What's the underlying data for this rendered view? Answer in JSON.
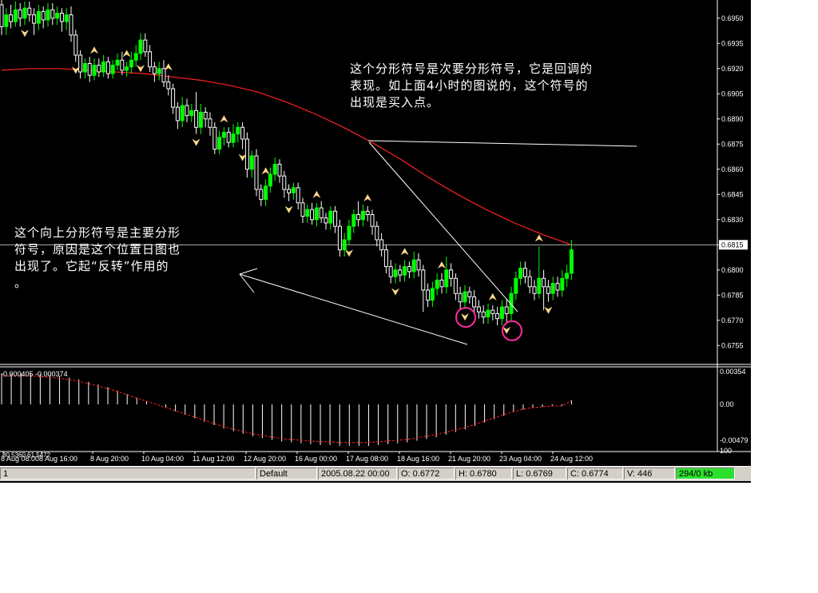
{
  "colors": {
    "background": "#000000",
    "grid_text": "#ffffff",
    "bull_candle": "#00ff00",
    "bear_candle": "#ffffff",
    "moving_average": "#ff2020",
    "fractal_arrow": "#ffd98a",
    "highlight_circle": "#ff2aa0",
    "indicator_bars": "#ffffff",
    "indicator_signal": "#ff2020",
    "traffic_indicator": "#2ee02e"
  },
  "price_axis": {
    "ticks": [
      "0.6950",
      "0.6935",
      "0.6920",
      "0.6905",
      "0.6890",
      "0.6875",
      "0.6860",
      "0.6845",
      "0.6830",
      "0.6815",
      "0.6800",
      "0.6785",
      "0.6770",
      "0.6755"
    ],
    "current_price": "0.6815"
  },
  "indicator": {
    "header": "-0.000405 -0.000374",
    "axis_ticks": [
      "0.00354",
      "0.00",
      "-0.00479",
      "100"
    ]
  },
  "time_axis": {
    "ticks": [
      "8 Aug 08:00",
      "8 Aug 16:00",
      "8 Aug 20:00",
      "10 Aug 04:00",
      "11 Aug 12:00",
      "12 Aug 20:00",
      "16 Aug 00:00",
      "17 Aug 08:00",
      "18 Aug 16:00",
      "21 Aug 20:00",
      "23 Aug 04:00",
      "24 Aug 12:00"
    ],
    "overlay_text": "80.5360  61.5472"
  },
  "annotations": {
    "note_right": "这个分形符号是次要分形符号，它是回调的\n表现。如上面4小时的图说的，这个符号的\n出现是买入点。",
    "note_left": "这个向上分形符号是主要分形\n符号，原因是这个位置日图也\n出现了。它起“反转”作用的\n。"
  },
  "status_bar": {
    "left": "1",
    "profile": "Default",
    "datetime": "2005.08.22 00:00",
    "open": "O: 0.6772",
    "high": "H: 0.6780",
    "low": "L: 0.6769",
    "close": "C: 0.6774",
    "volume": "V: 446",
    "traffic": "294/0 kb"
  },
  "chart_data": {
    "type": "candlestick",
    "price_range": [
      0.6748,
      0.6958
    ],
    "candles": [
      [
        0.6958,
        0.6945,
        0.6961,
        0.694
      ],
      [
        0.6945,
        0.6952,
        0.6956,
        0.694
      ],
      [
        0.6952,
        0.6948,
        0.6958,
        0.6944
      ],
      [
        0.6948,
        0.6955,
        0.696,
        0.6945
      ],
      [
        0.6955,
        0.695,
        0.6959,
        0.6945
      ],
      [
        0.695,
        0.6956,
        0.696,
        0.6946
      ],
      [
        0.6956,
        0.6952,
        0.696,
        0.6948
      ],
      [
        0.6952,
        0.6947,
        0.6956,
        0.694
      ],
      [
        0.6947,
        0.6954,
        0.6958,
        0.6943
      ],
      [
        0.6954,
        0.6949,
        0.6957,
        0.6944
      ],
      [
        0.6949,
        0.6955,
        0.6959,
        0.6945
      ],
      [
        0.6955,
        0.695,
        0.6959,
        0.6946
      ],
      [
        0.695,
        0.6953,
        0.6957,
        0.6946
      ],
      [
        0.6953,
        0.6948,
        0.6956,
        0.6942
      ],
      [
        0.6948,
        0.6952,
        0.6956,
        0.6943
      ],
      [
        0.6952,
        0.694,
        0.6957,
        0.6936
      ],
      [
        0.694,
        0.6928,
        0.6943,
        0.6924
      ],
      [
        0.6928,
        0.6918,
        0.6931,
        0.6914
      ],
      [
        0.6918,
        0.6923,
        0.6926,
        0.6914
      ],
      [
        0.6923,
        0.6916,
        0.6927,
        0.6912
      ],
      [
        0.6916,
        0.6922,
        0.6926,
        0.6913
      ],
      [
        0.6922,
        0.6918,
        0.6926,
        0.6915
      ],
      [
        0.6918,
        0.6924,
        0.6928,
        0.6915
      ],
      [
        0.6924,
        0.6917,
        0.6927,
        0.6914
      ],
      [
        0.6917,
        0.6922,
        0.6925,
        0.6914
      ],
      [
        0.6922,
        0.6925,
        0.6929,
        0.6919
      ],
      [
        0.6925,
        0.6919,
        0.693,
        0.6916
      ],
      [
        0.6919,
        0.6921,
        0.6924,
        0.6915
      ],
      [
        0.6921,
        0.6925,
        0.693,
        0.6917
      ],
      [
        0.6925,
        0.6929,
        0.6934,
        0.6921
      ],
      [
        0.6929,
        0.6937,
        0.6941,
        0.6925
      ],
      [
        0.6937,
        0.693,
        0.6941,
        0.6927
      ],
      [
        0.693,
        0.6921,
        0.6934,
        0.6918
      ],
      [
        0.6921,
        0.6917,
        0.6924,
        0.6912
      ],
      [
        0.6917,
        0.692,
        0.6924,
        0.6913
      ],
      [
        0.692,
        0.6912,
        0.6925,
        0.6909
      ],
      [
        0.6912,
        0.6908,
        0.6916,
        0.6904
      ],
      [
        0.6908,
        0.6897,
        0.6911,
        0.6893
      ],
      [
        0.6897,
        0.6889,
        0.69,
        0.6884
      ],
      [
        0.6889,
        0.6898,
        0.6903,
        0.6885
      ],
      [
        0.6898,
        0.6892,
        0.6902,
        0.6888
      ],
      [
        0.6892,
        0.6895,
        0.6899,
        0.6888
      ],
      [
        0.6895,
        0.6885,
        0.6906,
        0.6881
      ],
      [
        0.6885,
        0.6894,
        0.6899,
        0.6881
      ],
      [
        0.6894,
        0.689,
        0.6897,
        0.6885
      ],
      [
        0.689,
        0.6885,
        0.6894,
        0.688
      ],
      [
        0.6885,
        0.6872,
        0.6888,
        0.6869
      ],
      [
        0.6872,
        0.6879,
        0.6883,
        0.6869
      ],
      [
        0.6879,
        0.6882,
        0.6885,
        0.6874
      ],
      [
        0.6882,
        0.6876,
        0.6885,
        0.6873
      ],
      [
        0.6876,
        0.6881,
        0.6887,
        0.6873
      ],
      [
        0.6881,
        0.6885,
        0.6888,
        0.6876
      ],
      [
        0.6885,
        0.6878,
        0.6888,
        0.6872
      ],
      [
        0.6878,
        0.686,
        0.6882,
        0.6855
      ],
      [
        0.686,
        0.6868,
        0.6871,
        0.6855
      ],
      [
        0.6868,
        0.6848,
        0.6872,
        0.6844
      ],
      [
        0.6848,
        0.6842,
        0.6851,
        0.6838
      ],
      [
        0.6842,
        0.685,
        0.6854,
        0.6838
      ],
      [
        0.685,
        0.6857,
        0.6861,
        0.6846
      ],
      [
        0.6857,
        0.6863,
        0.6867,
        0.6853
      ],
      [
        0.6863,
        0.6856,
        0.6866,
        0.6852
      ],
      [
        0.6856,
        0.6848,
        0.6859,
        0.6843
      ],
      [
        0.6848,
        0.6846,
        0.6851,
        0.6841
      ],
      [
        0.6846,
        0.6849,
        0.6852,
        0.6842
      ],
      [
        0.6849,
        0.684,
        0.6852,
        0.6836
      ],
      [
        0.684,
        0.6832,
        0.6843,
        0.6828
      ],
      [
        0.6832,
        0.6836,
        0.6839,
        0.6828
      ],
      [
        0.6836,
        0.683,
        0.684,
        0.6827
      ],
      [
        0.683,
        0.6837,
        0.684,
        0.6826
      ],
      [
        0.6837,
        0.6831,
        0.6841,
        0.6828
      ],
      [
        0.6831,
        0.6828,
        0.6834,
        0.6824
      ],
      [
        0.6828,
        0.6835,
        0.6838,
        0.6824
      ],
      [
        0.6835,
        0.6826,
        0.6838,
        0.6822
      ],
      [
        0.6826,
        0.6812,
        0.683,
        0.6808
      ],
      [
        0.6812,
        0.6818,
        0.6822,
        0.6808
      ],
      [
        0.6818,
        0.6826,
        0.683,
        0.6815
      ],
      [
        0.6826,
        0.6833,
        0.6836,
        0.6822
      ],
      [
        0.6833,
        0.683,
        0.6841,
        0.6826
      ],
      [
        0.683,
        0.6835,
        0.6839,
        0.6826
      ],
      [
        0.6835,
        0.6833,
        0.6838,
        0.6829
      ],
      [
        0.6833,
        0.6826,
        0.6836,
        0.6821
      ],
      [
        0.6826,
        0.6818,
        0.6829,
        0.6814
      ],
      [
        0.6818,
        0.6812,
        0.6822,
        0.6808
      ],
      [
        0.6812,
        0.6802,
        0.6815,
        0.6798
      ],
      [
        0.6802,
        0.6796,
        0.6806,
        0.6792
      ],
      [
        0.6796,
        0.68,
        0.6804,
        0.6792
      ],
      [
        0.68,
        0.6797,
        0.6803,
        0.6793
      ],
      [
        0.6797,
        0.6802,
        0.6806,
        0.6793
      ],
      [
        0.6802,
        0.6799,
        0.6805,
        0.6795
      ],
      [
        0.6799,
        0.6806,
        0.6811,
        0.6795
      ],
      [
        0.6806,
        0.68,
        0.681,
        0.6796
      ],
      [
        0.68,
        0.6788,
        0.6803,
        0.6775
      ],
      [
        0.6788,
        0.6782,
        0.6792,
        0.6778
      ],
      [
        0.6782,
        0.6789,
        0.6793,
        0.6778
      ],
      [
        0.6789,
        0.6794,
        0.6798,
        0.6785
      ],
      [
        0.6794,
        0.679,
        0.6798,
        0.6786
      ],
      [
        0.679,
        0.68,
        0.6808,
        0.6786
      ],
      [
        0.68,
        0.6795,
        0.6804,
        0.679
      ],
      [
        0.6795,
        0.6786,
        0.6798,
        0.6782
      ],
      [
        0.6786,
        0.6781,
        0.679,
        0.6777
      ],
      [
        0.6781,
        0.6787,
        0.6791,
        0.6777
      ],
      [
        0.6787,
        0.6784,
        0.679,
        0.678
      ],
      [
        0.6784,
        0.6778,
        0.6788,
        0.6774
      ],
      [
        0.6778,
        0.6775,
        0.6782,
        0.6771
      ],
      [
        0.6775,
        0.6772,
        0.6779,
        0.6768
      ],
      [
        0.6772,
        0.6776,
        0.678,
        0.6768
      ],
      [
        0.6776,
        0.6774,
        0.6779,
        0.677
      ],
      [
        0.6774,
        0.6771,
        0.6778,
        0.6767
      ],
      [
        0.6771,
        0.6778,
        0.6782,
        0.6767
      ],
      [
        0.6778,
        0.6774,
        0.6783,
        0.6769
      ],
      [
        0.6774,
        0.6786,
        0.679,
        0.6769
      ],
      [
        0.6786,
        0.6795,
        0.6799,
        0.6782
      ],
      [
        0.6795,
        0.6801,
        0.6805,
        0.6791
      ],
      [
        0.6801,
        0.6796,
        0.6805,
        0.6792
      ],
      [
        0.6796,
        0.679,
        0.68,
        0.6786
      ],
      [
        0.679,
        0.6786,
        0.6794,
        0.6782
      ],
      [
        0.6786,
        0.6795,
        0.6814,
        0.6783
      ],
      [
        0.6795,
        0.679,
        0.68,
        0.6776
      ],
      [
        0.679,
        0.6786,
        0.6794,
        0.6781
      ],
      [
        0.6786,
        0.6792,
        0.6796,
        0.6782
      ],
      [
        0.6792,
        0.6788,
        0.6796,
        0.6784
      ],
      [
        0.6788,
        0.6795,
        0.68,
        0.6784
      ],
      [
        0.6795,
        0.6798,
        0.6803,
        0.679
      ],
      [
        0.6798,
        0.6812,
        0.6818,
        0.6794
      ]
    ],
    "fractals": [
      {
        "index": 5,
        "dir": "down"
      },
      {
        "index": 16,
        "dir": "down"
      },
      {
        "index": 20,
        "dir": "up"
      },
      {
        "index": 27,
        "dir": "up"
      },
      {
        "index": 30,
        "dir": "down"
      },
      {
        "index": 36,
        "dir": "up"
      },
      {
        "index": 42,
        "dir": "down"
      },
      {
        "index": 48,
        "dir": "up"
      },
      {
        "index": 52,
        "dir": "down"
      },
      {
        "index": 57,
        "dir": "up"
      },
      {
        "index": 62,
        "dir": "down"
      },
      {
        "index": 68,
        "dir": "up"
      },
      {
        "index": 75,
        "dir": "down"
      },
      {
        "index": 79,
        "dir": "up"
      },
      {
        "index": 85,
        "dir": "down"
      },
      {
        "index": 87,
        "dir": "up"
      },
      {
        "index": 95,
        "dir": "up"
      },
      {
        "index": 100,
        "dir": "down"
      },
      {
        "index": 106,
        "dir": "up"
      },
      {
        "index": 109,
        "dir": "down"
      },
      {
        "index": 116,
        "dir": "up"
      },
      {
        "index": 118,
        "dir": "down"
      }
    ],
    "moving_average": [
      0.6919,
      0.692,
      0.692,
      0.6919,
      0.6918,
      0.6917,
      0.6915,
      0.6913,
      0.691,
      0.6906,
      0.69,
      0.6893,
      0.6885,
      0.6876,
      0.6866,
      0.6855,
      0.6845,
      0.6836,
      0.6828,
      0.6821,
      0.6815
    ],
    "indicator_histogram": [
      0.0036,
      0.0036,
      0.0036,
      0.0036,
      0.0035,
      0.0034,
      0.0033,
      0.0031,
      0.0029,
      0.0026,
      0.0023,
      0.002,
      0.0016,
      0.0012,
      0.0008,
      0.0004,
      0.0,
      -0.0004,
      -0.0008,
      -0.0012,
      -0.0016,
      -0.002,
      -0.0024,
      -0.0028,
      -0.0031,
      -0.0034,
      -0.0037,
      -0.0039,
      -0.0041,
      -0.0043,
      -0.0044,
      -0.0045,
      -0.0046,
      -0.0047,
      -0.0047,
      -0.0048,
      -0.0048,
      -0.0048,
      -0.0048,
      -0.0047,
      -0.0046,
      -0.0045,
      -0.0044,
      -0.0042,
      -0.004,
      -0.0038,
      -0.0035,
      -0.0032,
      -0.0029,
      -0.0025,
      -0.0021,
      -0.0017,
      -0.0013,
      -0.0009,
      -0.0006,
      -0.0004,
      -0.0003,
      -0.0002,
      -0.0002,
      0.0005
    ]
  }
}
